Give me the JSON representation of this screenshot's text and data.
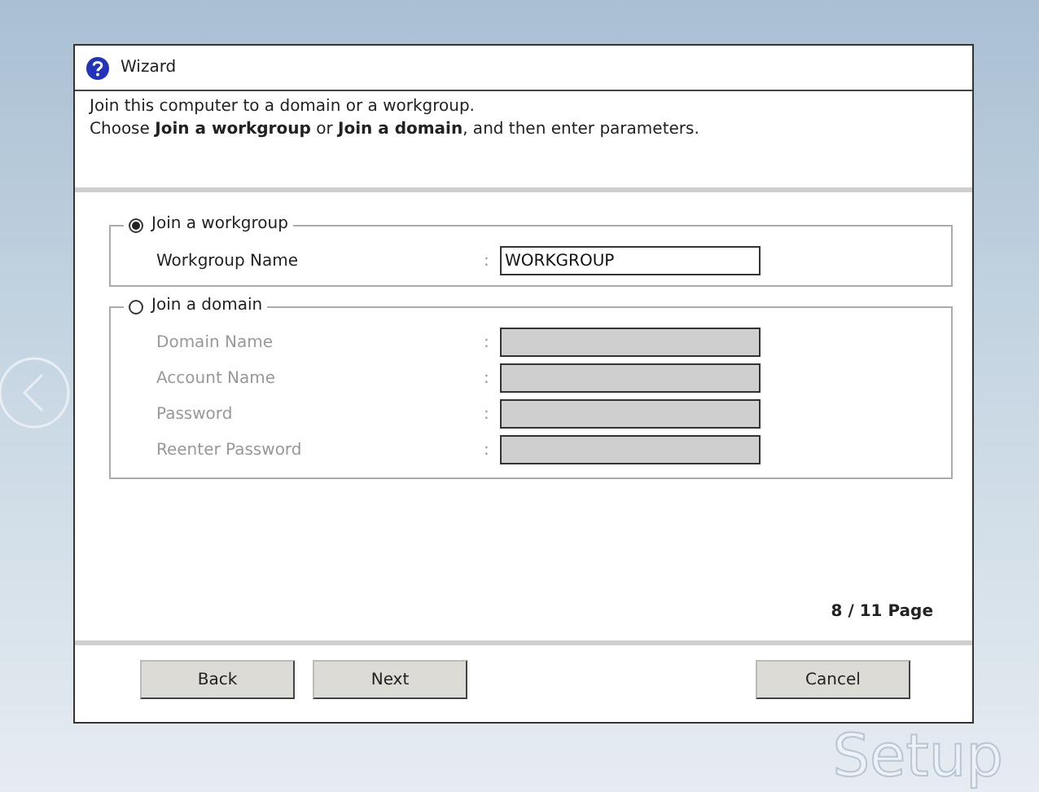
{
  "background": {
    "logo_text": "Setup"
  },
  "window": {
    "title": "Wizard"
  },
  "description": [
    "Join this computer to a domain or a workgroup.",
    "Choose **Join a workgroup** or **Join a domain**, and then enter parameters."
  ],
  "options": [
    {
      "label": "Join a workgroup",
      "selected": true,
      "fields": [
        {
          "label": "Workgroup Name",
          "separator": ":",
          "value": "WORKGROUP",
          "disabled": false
        }
      ]
    },
    {
      "label": "Join a domain",
      "selected": false,
      "fields": [
        {
          "label": "Domain Name",
          "separator": ":",
          "disabled": true
        },
        {
          "label": "Account Name",
          "separator": ":",
          "disabled": true
        },
        {
          "label": "Password",
          "separator": ":",
          "disabled": true
        },
        {
          "label": "Reenter Password",
          "separator": ":",
          "disabled": true
        }
      ]
    }
  ],
  "page_indicator": "8 / 11 Page",
  "buttons": [
    {
      "label": "Back",
      "kind": "nav"
    },
    {
      "label": "Next",
      "kind": "nav"
    },
    {
      "label": "Cancel",
      "kind": "cancel"
    }
  ]
}
